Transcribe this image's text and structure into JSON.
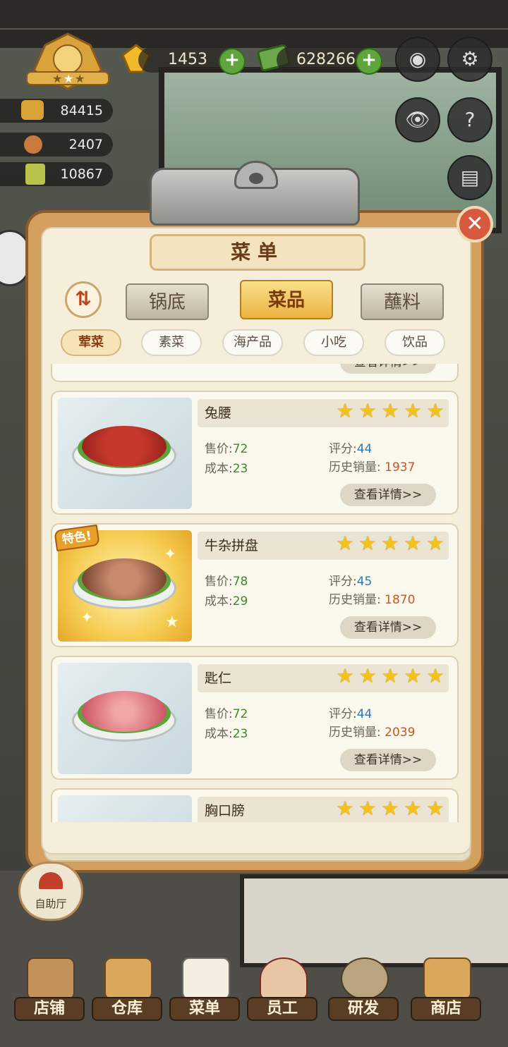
{
  "hud": {
    "gems": "1453",
    "cash": "628266",
    "stats": [
      "84415",
      "2407",
      "10867"
    ],
    "icons": [
      "camera-icon",
      "gear-icon",
      "eye-icon",
      "help-book-icon",
      "recipe-book-icon"
    ]
  },
  "menu": {
    "title": "菜单",
    "close_label": "✕",
    "sort_label": "⇅",
    "tabs": [
      "锅底",
      "菜品",
      "蘸料"
    ],
    "active_tab": "菜品",
    "categories": [
      "荤菜",
      "素菜",
      "海产品",
      "小吃",
      "饮品"
    ],
    "active_category": "荤菜",
    "labels": {
      "price": "售价",
      "cost": "成本",
      "score": "评分",
      "sales": "历史销量",
      "detail": "查看详情>>",
      "special": "特色!"
    },
    "dishes": [
      {
        "name": "兔腰",
        "price": "72",
        "cost": "23",
        "score": "44",
        "sales": "1937",
        "stars": 5,
        "special": false
      },
      {
        "name": "牛杂拼盘",
        "price": "78",
        "cost": "29",
        "score": "45",
        "sales": "1870",
        "stars": 5,
        "special": true
      },
      {
        "name": "匙仁",
        "price": "72",
        "cost": "23",
        "score": "44",
        "sales": "2039",
        "stars": 5,
        "special": false
      },
      {
        "name": "胸口膀",
        "stars": 5,
        "special": false
      }
    ]
  },
  "nav": {
    "self_service": "自助厅",
    "items": [
      "店铺",
      "仓库",
      "菜单",
      "员工",
      "研发",
      "商店"
    ]
  },
  "colors": {
    "board": "#d3a05f",
    "paper": "#f4eedb",
    "active_tab": "#eab342",
    "star": "#f5c316",
    "price_green": "#3d8a2b",
    "score_blue": "#2f78b7",
    "sales_orange": "#c15a2a"
  }
}
